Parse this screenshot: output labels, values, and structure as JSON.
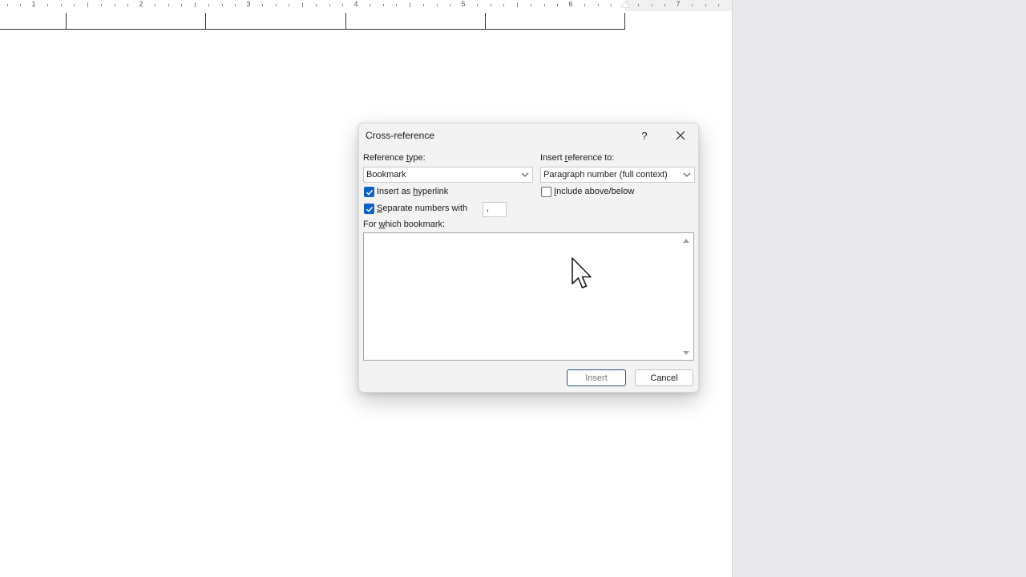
{
  "ruler": {
    "numbers": [
      "1",
      "2",
      "3",
      "4",
      "5",
      "6",
      "7"
    ]
  },
  "dialog": {
    "title": "Cross-reference",
    "help_label": "?",
    "reference_type": {
      "label_pre": "Reference ",
      "label_u": "t",
      "label_post": "ype:",
      "value": "Bookmark"
    },
    "insert_reference_to": {
      "label_pre": "Insert ",
      "label_u": "r",
      "label_post": "eference to:",
      "value": "Paragraph number (full context)"
    },
    "insert_as_hyperlink": {
      "label_pre": "Insert as ",
      "label_u": "h",
      "label_post": "yperlink",
      "checked": true
    },
    "include_above_below": {
      "label_pre": "",
      "label_u": "I",
      "label_post": "nclude above/below",
      "checked": false
    },
    "separate_numbers": {
      "label_pre": "",
      "label_u": "S",
      "label_post": "eparate numbers with",
      "checked": true,
      "value": ","
    },
    "for_which": {
      "label_pre": "For ",
      "label_u": "w",
      "label_post": "hich bookmark:"
    },
    "insert_button": "Insert",
    "cancel_button": "Cancel"
  },
  "colors": {
    "accent": "#0f62c4",
    "dialog_bg": "#f3f3f3",
    "side_bg": "#e9e8ec"
  }
}
